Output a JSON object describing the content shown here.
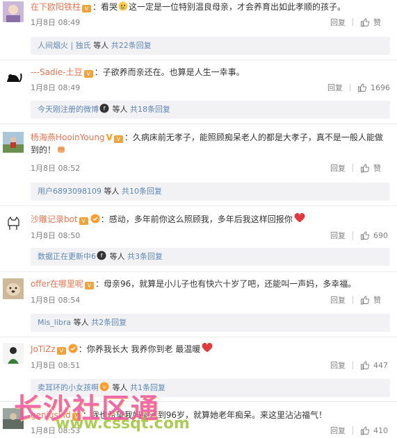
{
  "comments": [
    {
      "username": "在下欧阳铁柱",
      "prefix": "：看哭",
      "text": "这一定是一位特别温良母亲，才会养育出如此孝顺的孩子。",
      "time": "1月8日 08:49",
      "reply_label": "回复",
      "like_label": "赞",
      "reply_summary": {
        "users": "人间烟火 | 独氏",
        "suffix": " 等人 ",
        "total": "共22条回复"
      }
    },
    {
      "username": "---Sadie-土豆",
      "prefix": "：",
      "text": "子欲养而亲还在。也算是人生一幸事。",
      "time": "1月8日 08:49",
      "reply_label": "回复",
      "like_label": "1696",
      "reply_summary": {
        "users": "今天刚注册的微博",
        "suffix": " 等人 ",
        "total": "共18条回复"
      }
    },
    {
      "username": "杨海燕HooinYoung",
      "prefix": "：",
      "text": "久病床前无孝子，能照顾痴呆老人的都是大孝子，真不是一般人能做",
      "text2": "到的！",
      "time": "1月8日 08:52",
      "reply_label": "回复",
      "like_label": "赞",
      "reply_summary": {
        "users": "用户6893098109",
        "suffix": " 等人 ",
        "total": "共10条回复"
      }
    },
    {
      "username": "沙雕记录bot",
      "prefix": "：",
      "text": "感动，多年前你这么照顾我，多年后我这样回报你",
      "time": "1月8日 08:50",
      "reply_label": "回复",
      "like_label": "690",
      "reply_summary": {
        "users": "数据正在更新中6",
        "suffix": " 等人 ",
        "total": "共3条回复"
      }
    },
    {
      "username": "offer在哪里呢",
      "prefix": "：",
      "text": "母亲96，就算是小儿子也有快六十岁了吧，还能叫一声妈，多幸福。",
      "time": "1月8日 08:54",
      "reply_label": "回复",
      "like_label": "赞",
      "reply_summary": {
        "users": "Mis_libra",
        "suffix": " 等人 ",
        "total": "共2条回复"
      }
    },
    {
      "username": "JoTiZz",
      "prefix": "：",
      "text": "你养我长大  我养你到老  最温暖",
      "time": "1月8日 08:51",
      "reply_label": "回复",
      "like_label": "447",
      "reply_summary": {
        "users": "卖耳环的小女孩啊",
        "suffix": " 等人 ",
        "total": "共1条回复"
      }
    },
    {
      "username": "geniuskid",
      "prefix": "：",
      "text": "我也希望我妈能活到96岁，就算她老年痴呆。来这里沾沾福气！",
      "time": "1月8日 08:53",
      "reply_label": "回复",
      "like_label": "410"
    }
  ],
  "watermark": {
    "title": "长沙社区通",
    "url": "www.cssqt.com"
  },
  "colors": {
    "link": "#5d87b8",
    "username": "#eb7350",
    "meta": "#808080",
    "reply_bg": "#f2f2f5",
    "heart": "#e0393e"
  }
}
